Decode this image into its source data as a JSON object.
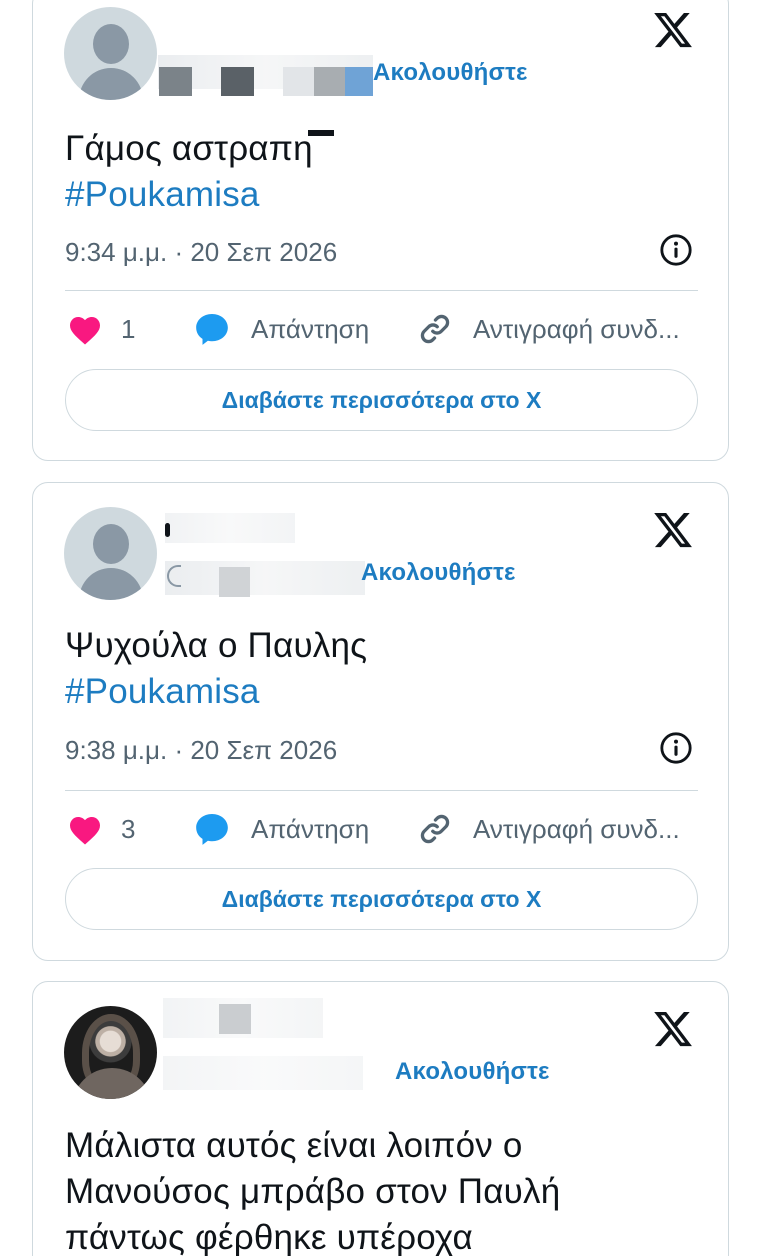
{
  "tweets": [
    {
      "follow_label": "Ακολουθήστε",
      "text": "Γάμος αστραπη",
      "hashtag": "#Poukamisa",
      "timestamp": "9:34 μ.μ. · 20 Σεπ 2026",
      "likes": "1",
      "reply_label": "Απάντηση",
      "copy_label": "Αντιγραφή συνδ...",
      "read_more_label": "Διαβάστε περισσότερα στο X"
    },
    {
      "follow_label": "Ακολουθήστε",
      "text": "Ψυχούλα ο Παυλης",
      "hashtag": "#Poukamisa",
      "timestamp": "9:38 μ.μ. · 20 Σεπ 2026",
      "likes": "3",
      "reply_label": "Απάντηση",
      "copy_label": "Αντιγραφή συνδ...",
      "read_more_label": "Διαβάστε περισσότερα στο X"
    },
    {
      "follow_label": "Ακολουθήστε",
      "text_lines": [
        "Μάλιστα αυτός είναι λοιπόν ο",
        "Μανούσος μπράβο στον Παυλή",
        "πάντως φέρθηκε υπέροχα"
      ]
    }
  ],
  "icons": {
    "logo": "x-logo-icon",
    "avatar": "default-avatar-icon",
    "like": "heart-icon",
    "reply": "speech-bubble-icon",
    "copy": "link-icon",
    "info": "info-icon"
  },
  "colors": {
    "accent": "#1d7cc1",
    "heart": "#f91880",
    "muted": "#536471",
    "border": "#cfd9de"
  }
}
